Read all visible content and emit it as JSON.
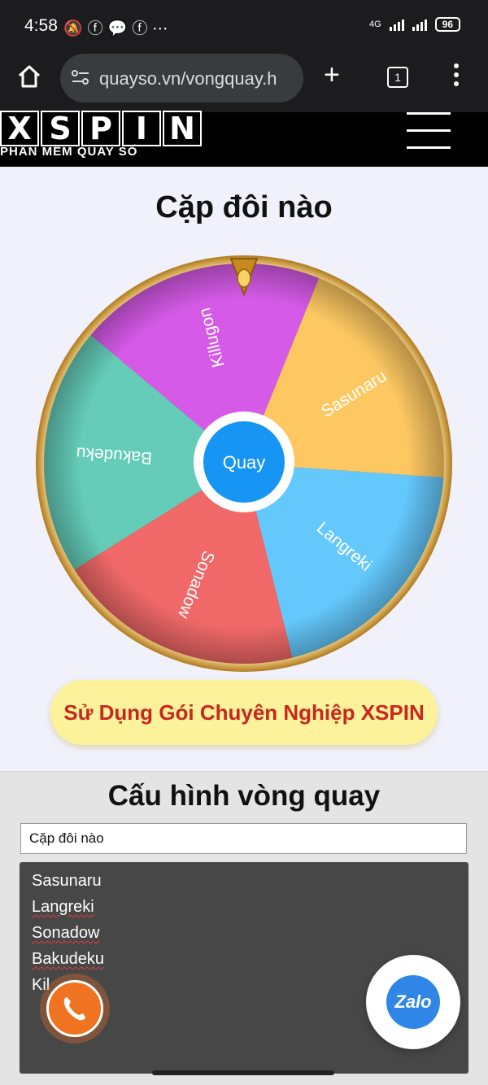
{
  "status_bar": {
    "time": "4:58",
    "notification_icons": [
      "mute-icon",
      "facebook-icon",
      "messenger-icon",
      "facebook-icon",
      "more-icon"
    ],
    "network": "4G",
    "battery": "96"
  },
  "browser": {
    "url": "quayso.vn/vongquay.h",
    "tab_count": "1"
  },
  "site": {
    "logo_text": "XSPIN",
    "logo_letters": [
      "X",
      "S",
      "P",
      "I",
      "N"
    ],
    "logo_subtitle": "PHẦN MỀM QUAY SỐ"
  },
  "wheel": {
    "title": "Cặp đôi nào",
    "spin_label": "Quay",
    "segments": [
      {
        "label": "Sasunaru",
        "color": "#fdc862"
      },
      {
        "label": "Langreki",
        "color": "#64c8fc"
      },
      {
        "label": "Sonadow",
        "color": "#f06868"
      },
      {
        "label": "Bakudeku",
        "color": "#64ccb8"
      },
      {
        "label": "Killugon",
        "color": "#d65ae8"
      }
    ],
    "rim_color": "#d4a43a"
  },
  "pro_banner": {
    "label": "Sử Dụng Gói Chuyên Nghiệp XSPIN"
  },
  "config": {
    "title": "Cấu hình vòng quay",
    "wheel_title_value": "Cặp đôi nào",
    "items": [
      "Sasunaru",
      "Langreki",
      "Sonadow",
      "Bakudeku",
      "Kil"
    ]
  },
  "floating": {
    "zalo_label": "Zalo"
  }
}
